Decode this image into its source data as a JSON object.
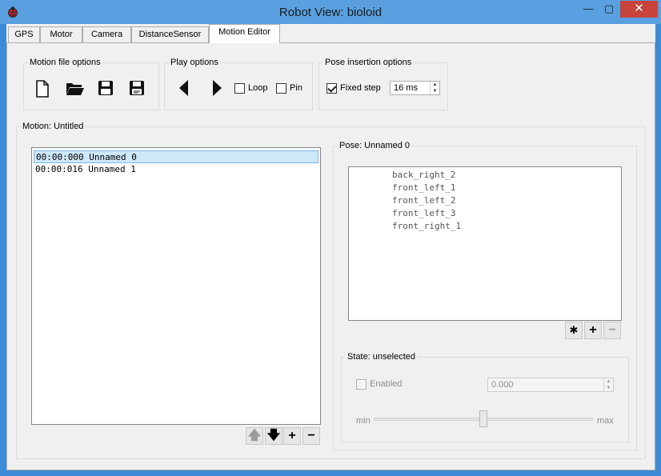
{
  "window": {
    "title": "Robot View: bioloid",
    "minimize_glyph": "—",
    "maximize_glyph": "▢",
    "close_glyph": "✕"
  },
  "tabs": [
    {
      "label": "GPS"
    },
    {
      "label": "Motor"
    },
    {
      "label": "Camera"
    },
    {
      "label": "DistanceSensor"
    },
    {
      "label": "Motion Editor"
    }
  ],
  "motion_file_options": {
    "title": "Motion file options",
    "icons": [
      "new-file-icon",
      "open-folder-icon",
      "save-icon",
      "save-as-icon"
    ]
  },
  "play_options": {
    "title": "Play options",
    "loop_label": "Loop",
    "loop_checked": false,
    "pin_label": "Pin",
    "pin_checked": false
  },
  "pose_insertion_options": {
    "title": "Pose insertion options",
    "fixed_step_label": "Fixed step",
    "fixed_step_checked": true,
    "step_value": "16 ms"
  },
  "motion": {
    "title": "Motion: Untitled",
    "poses": [
      {
        "text": "00:00:000 Unnamed 0",
        "selected": true
      },
      {
        "text": "00:00:016 Unnamed 1",
        "selected": false
      }
    ],
    "buttons": {
      "up": "🡅",
      "down": "🡇",
      "add": "+",
      "remove": "−"
    }
  },
  "pose": {
    "title": "Pose: Unnamed 0",
    "items": [
      "back_right_2",
      "front_left_1",
      "front_left_2",
      "front_left_3",
      "front_right_1"
    ],
    "buttons": {
      "asterisk": "✱",
      "add": "+",
      "remove": "−"
    }
  },
  "state": {
    "title": "State: unselected",
    "enabled_label": "Enabled",
    "enabled_checked": false,
    "value": "0.000",
    "min_label": "min",
    "max_label": "max",
    "slider_fraction": 0.5
  },
  "colors": {
    "titlebar": "#5aa0e0",
    "close_button": "#c7433b",
    "selection": "#cde8f8"
  }
}
